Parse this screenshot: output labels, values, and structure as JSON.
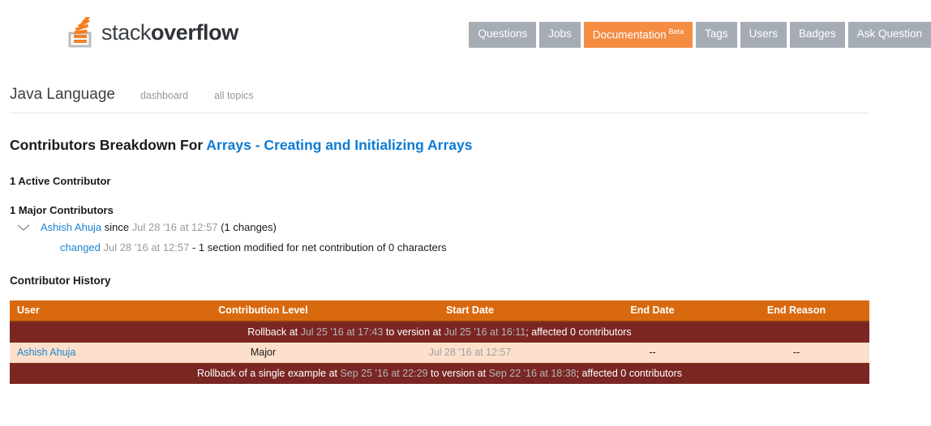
{
  "header": {
    "logo": {
      "icon": "stackoverflow-logo-icon",
      "text_light": "stack",
      "text_bold": "overflow"
    },
    "nav": [
      {
        "label": "Questions",
        "active": false
      },
      {
        "label": "Jobs",
        "active": false
      },
      {
        "label": "Documentation",
        "badge": "Beta",
        "active": true
      },
      {
        "label": "Tags",
        "active": false
      },
      {
        "label": "Users",
        "active": false
      },
      {
        "label": "Badges",
        "active": false
      },
      {
        "label": "Ask Question",
        "active": false
      }
    ],
    "colors": {
      "nav_default": "#a5acb4",
      "nav_active": "#f48c42"
    }
  },
  "breadcrumb": {
    "title": "Java Language",
    "link_dashboard": "dashboard",
    "link_all_topics": "all topics"
  },
  "main": {
    "title_prefix": "Contributors Breakdown For ",
    "title_topic": "Arrays - Creating and Initializing Arrays",
    "active_contributors": "1 Active Contributor",
    "major_contributors": "1 Major Contributors",
    "contributor": {
      "chevron": "chevron-down-icon",
      "name": "Ashish Ahuja",
      "since_label": " since ",
      "since_date": "Jul 28 '16 at 12:57",
      "changes_count": " (1 changes)"
    },
    "change_entry": {
      "link": "changed",
      "date": "Jul 28 '16 at 12:57",
      "description": " - 1 section modified for net contribution of 0 characters"
    },
    "history_heading": "Contributor History"
  },
  "table": {
    "columns": [
      "User",
      "Contribution Level",
      "Start Date",
      "End Date",
      "End Reason"
    ],
    "rows": [
      {
        "type": "rollback",
        "text_1": "Rollback at ",
        "date_1": "Jul 25 '16 at 17:43",
        "text_2": " to version at ",
        "date_2": "Jul 25 '16 at 16:11",
        "text_3": "; affected 0 contributors"
      },
      {
        "type": "data",
        "user": "Ashish Ahuja",
        "contribution_level": "Major",
        "start_date": "Jul 28 '16 at 12:57",
        "end_date": "--",
        "end_reason": "--"
      },
      {
        "type": "rollback",
        "text_1": "Rollback of a single example at ",
        "date_1": "Sep 25 '16 at 22:29",
        "text_2": " to version at ",
        "date_2": "Sep 22 '16 at 18:38",
        "text_3": "; affected 0 contributors"
      }
    ],
    "colors": {
      "header_bg": "#d9690f",
      "rollback_bg": "#7a2622",
      "data_bg": "#fce0cb"
    }
  }
}
